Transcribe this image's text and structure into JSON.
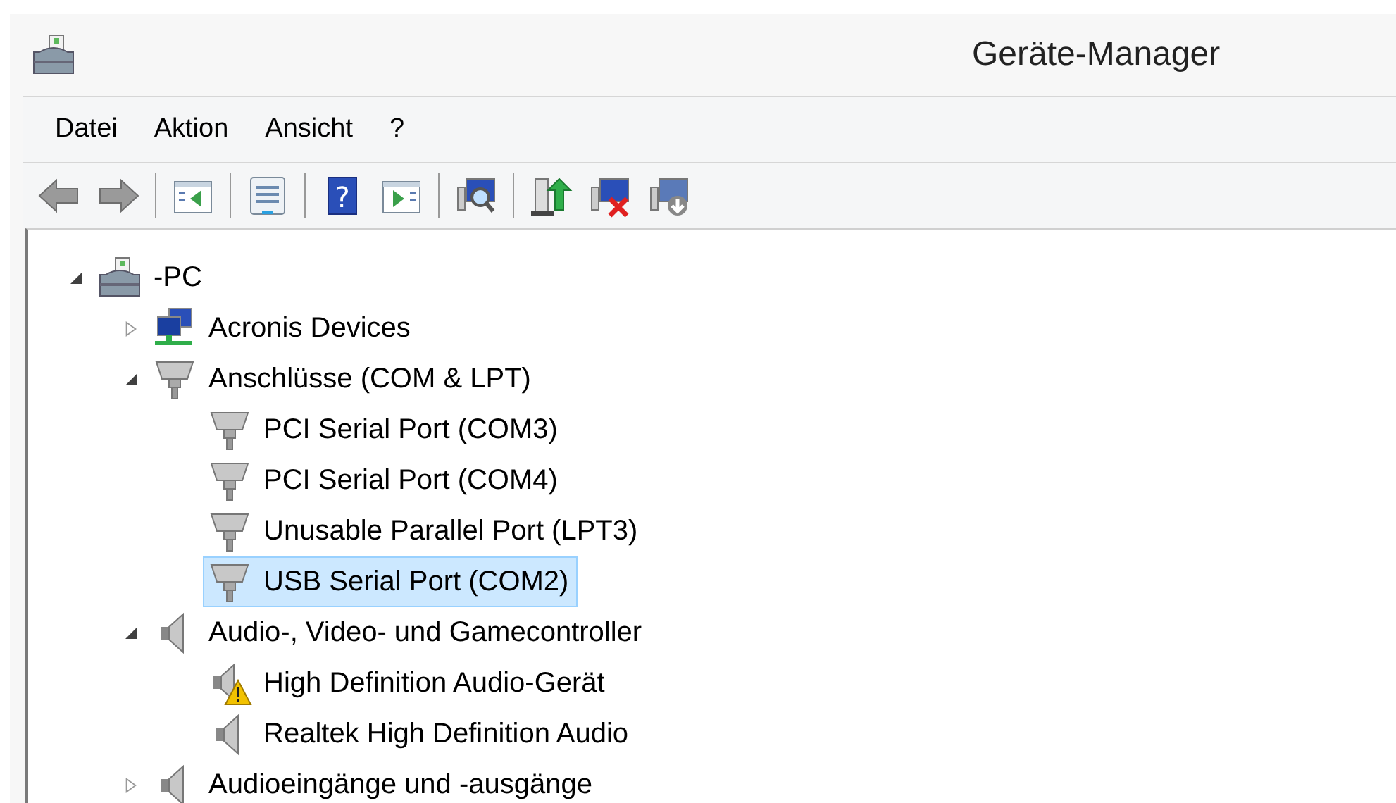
{
  "window": {
    "title": "Geräte-Manager"
  },
  "menu": [
    "Datei",
    "Aktion",
    "Ansicht",
    "?"
  ],
  "toolbar": [
    {
      "kind": "back"
    },
    {
      "kind": "forward"
    },
    {
      "kind": "separator"
    },
    {
      "kind": "panel-left"
    },
    {
      "kind": "separator"
    },
    {
      "kind": "properties"
    },
    {
      "kind": "separator"
    },
    {
      "kind": "help",
      "glyph": "?"
    },
    {
      "kind": "panel-right"
    },
    {
      "kind": "separator"
    },
    {
      "kind": "scan"
    },
    {
      "kind": "separator"
    },
    {
      "kind": "update"
    },
    {
      "kind": "uninstall"
    },
    {
      "kind": "disable"
    }
  ],
  "tree": [
    {
      "label": "-PC",
      "kind": "computer",
      "expanded": true,
      "selected": false,
      "children": [
        {
          "label": "Acronis Devices",
          "kind": "network",
          "expanded": false,
          "selected": false
        },
        {
          "label": "Anschlüsse (COM & LPT)",
          "kind": "port",
          "expanded": true,
          "selected": false,
          "children": [
            {
              "label": "PCI Serial Port (COM3)",
              "kind": "port",
              "selected": false
            },
            {
              "label": "PCI Serial Port (COM4)",
              "kind": "port",
              "selected": false
            },
            {
              "label": "Unusable Parallel Port (LPT3)",
              "kind": "port",
              "selected": false
            },
            {
              "label": "USB Serial Port (COM2)",
              "kind": "port",
              "selected": true
            }
          ]
        },
        {
          "label": "Audio-, Video- und Gamecontroller",
          "kind": "speaker",
          "expanded": true,
          "selected": false,
          "children": [
            {
              "label": "High Definition Audio-Gerät",
              "kind": "speaker-warning",
              "selected": false
            },
            {
              "label": "Realtek High Definition Audio",
              "kind": "speaker",
              "selected": false
            }
          ]
        },
        {
          "label": "Audioeingänge und -ausgänge",
          "kind": "speaker",
          "expanded": false,
          "selected": false
        }
      ]
    }
  ]
}
